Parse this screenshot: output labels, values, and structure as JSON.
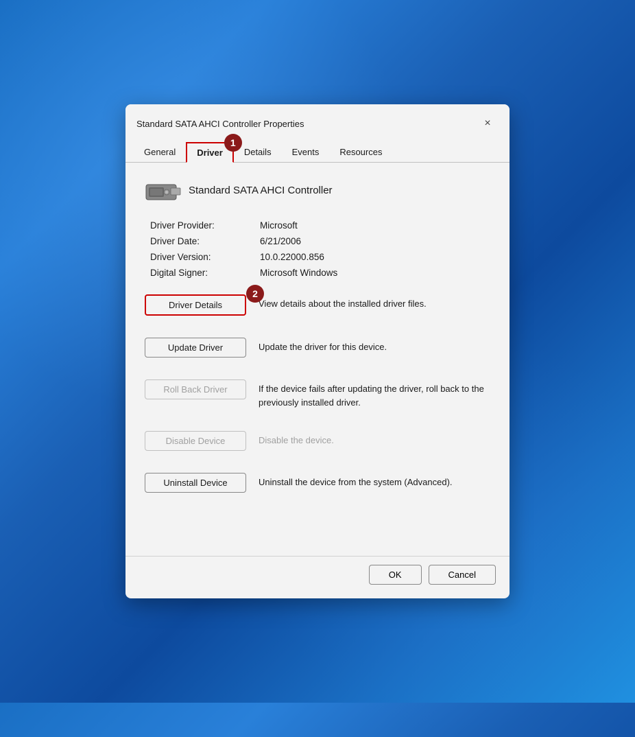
{
  "background": {
    "type": "windows11-wallpaper"
  },
  "dialog": {
    "title": "Standard SATA AHCI Controller Properties",
    "close_label": "×",
    "tabs": [
      {
        "id": "general",
        "label": "General",
        "active": false
      },
      {
        "id": "driver",
        "label": "Driver",
        "active": true
      },
      {
        "id": "details",
        "label": "Details",
        "active": false
      },
      {
        "id": "events",
        "label": "Events",
        "active": false
      },
      {
        "id": "resources",
        "label": "Resources",
        "active": false
      }
    ],
    "badge1": "1",
    "badge2": "2",
    "device_name": "Standard SATA AHCI Controller",
    "info_rows": [
      {
        "label": "Driver Provider:",
        "value": "Microsoft"
      },
      {
        "label": "Driver Date:",
        "value": "6/21/2006"
      },
      {
        "label": "Driver Version:",
        "value": "10.0.22000.856"
      },
      {
        "label": "Digital Signer:",
        "value": "Microsoft Windows"
      }
    ],
    "actions": [
      {
        "id": "driver-details",
        "label": "Driver Details",
        "description": "View details about the installed driver files.",
        "disabled": false,
        "highlighted": true
      },
      {
        "id": "update-driver",
        "label": "Update Driver",
        "description": "Update the driver for this device.",
        "disabled": false,
        "highlighted": false
      },
      {
        "id": "roll-back-driver",
        "label": "Roll Back Driver",
        "description": "If the device fails after updating the driver, roll back to the previously installed driver.",
        "disabled": true,
        "highlighted": false
      },
      {
        "id": "disable-device",
        "label": "Disable Device",
        "description": "Disable the device.",
        "disabled": true,
        "highlighted": false
      },
      {
        "id": "uninstall-device",
        "label": "Uninstall Device",
        "description": "Uninstall the device from the system (Advanced).",
        "disabled": false,
        "highlighted": false
      }
    ],
    "footer": {
      "ok_label": "OK",
      "cancel_label": "Cancel"
    }
  }
}
